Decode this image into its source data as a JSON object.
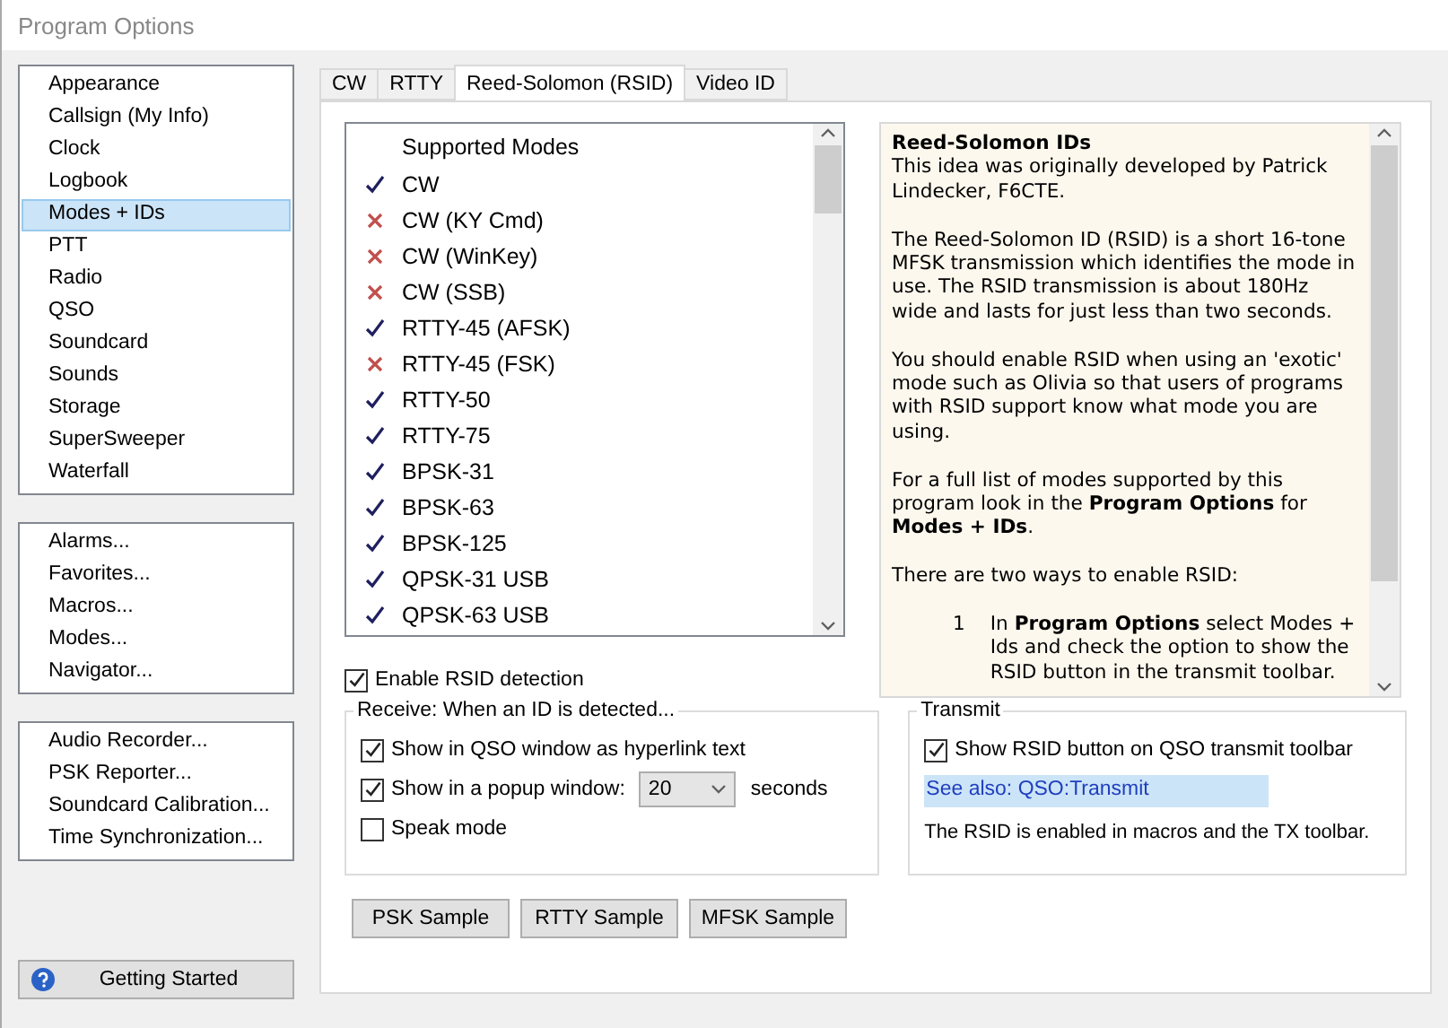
{
  "window": {
    "title": "Program Options"
  },
  "sidebar": {
    "groups": [
      {
        "items": [
          {
            "label": "Appearance",
            "selected": false
          },
          {
            "label": "Callsign (My Info)",
            "selected": false
          },
          {
            "label": "Clock",
            "selected": false
          },
          {
            "label": "Logbook",
            "selected": false
          },
          {
            "label": "Modes + IDs",
            "selected": true
          },
          {
            "label": "PTT",
            "selected": false
          },
          {
            "label": "Radio",
            "selected": false
          },
          {
            "label": "QSO",
            "selected": false
          },
          {
            "label": "Soundcard",
            "selected": false
          },
          {
            "label": "Sounds",
            "selected": false
          },
          {
            "label": "Storage",
            "selected": false
          },
          {
            "label": "SuperSweeper",
            "selected": false
          },
          {
            "label": "Waterfall",
            "selected": false
          }
        ]
      },
      {
        "items": [
          {
            "label": "Alarms...",
            "selected": false
          },
          {
            "label": "Favorites...",
            "selected": false
          },
          {
            "label": "Macros...",
            "selected": false
          },
          {
            "label": "Modes...",
            "selected": false
          },
          {
            "label": "Navigator...",
            "selected": false
          }
        ]
      },
      {
        "items": [
          {
            "label": "Audio Recorder...",
            "selected": false
          },
          {
            "label": "PSK Reporter...",
            "selected": false
          },
          {
            "label": "Soundcard Calibration...",
            "selected": false
          },
          {
            "label": "Time Synchronization...",
            "selected": false
          }
        ]
      }
    ],
    "getting_started": "Getting Started"
  },
  "tabs": [
    {
      "label": "CW",
      "selected": false
    },
    {
      "label": "RTTY",
      "selected": false
    },
    {
      "label": "Reed-Solomon (RSID)",
      "selected": true
    },
    {
      "label": "Video ID",
      "selected": false
    }
  ],
  "modes": {
    "header": "Supported Modes",
    "rows": [
      {
        "name": "CW",
        "supported": true
      },
      {
        "name": "CW (KY Cmd)",
        "supported": false
      },
      {
        "name": "CW (WinKey)",
        "supported": false
      },
      {
        "name": "CW (SSB)",
        "supported": false
      },
      {
        "name": "RTTY-45 (AFSK)",
        "supported": true
      },
      {
        "name": "RTTY-45 (FSK)",
        "supported": false
      },
      {
        "name": "RTTY-50",
        "supported": true
      },
      {
        "name": "RTTY-75",
        "supported": true
      },
      {
        "name": "BPSK-31",
        "supported": true
      },
      {
        "name": "BPSK-63",
        "supported": true
      },
      {
        "name": "BPSK-125",
        "supported": true
      },
      {
        "name": "QPSK-31 USB",
        "supported": true
      },
      {
        "name": "QPSK-63 USB",
        "supported": true
      }
    ]
  },
  "help": {
    "title": "Reed-Solomon IDs",
    "paragraphs": [
      "This idea was originally developed by Patrick Lindecker, F6CTE.",
      "The Reed-Solomon ID (RSID) is a short 16-tone MFSK transmission which identifies the mode in use. The RSID transmission is about 180Hz wide and lasts for just less than two seconds.",
      "You should enable RSID when using an 'exotic' mode such as Olivia so that users of programs with RSID support know what mode you are using.",
      "For a full list of modes supported by this program look in the **Program Options** for **Modes + IDs**.",
      "There are two ways to enable RSID:"
    ],
    "steps": [
      {
        "number": "1",
        "text": "In **Program Options** select Modes + Ids and check the option to show the RSID button in the transmit toolbar."
      }
    ]
  },
  "enable_detection": {
    "label": "Enable RSID detection",
    "checked": true
  },
  "receive": {
    "title": "Receive: When an ID is detected...",
    "hyperlink": {
      "label": "Show in QSO window as hyperlink text",
      "checked": true
    },
    "popup": {
      "label": "Show in a popup window:",
      "checked": true,
      "value": "20",
      "unit": "seconds"
    },
    "speak": {
      "label": "Speak mode",
      "checked": false
    }
  },
  "transmit": {
    "title": "Transmit",
    "show_button": {
      "label": "Show RSID button on QSO transmit toolbar",
      "checked": true
    },
    "see_also": "See also: QSO:Transmit",
    "note": "The RSID is enabled in macros and the TX toolbar."
  },
  "buttons": [
    "PSK Sample",
    "RTTY Sample",
    "MFSK Sample"
  ]
}
